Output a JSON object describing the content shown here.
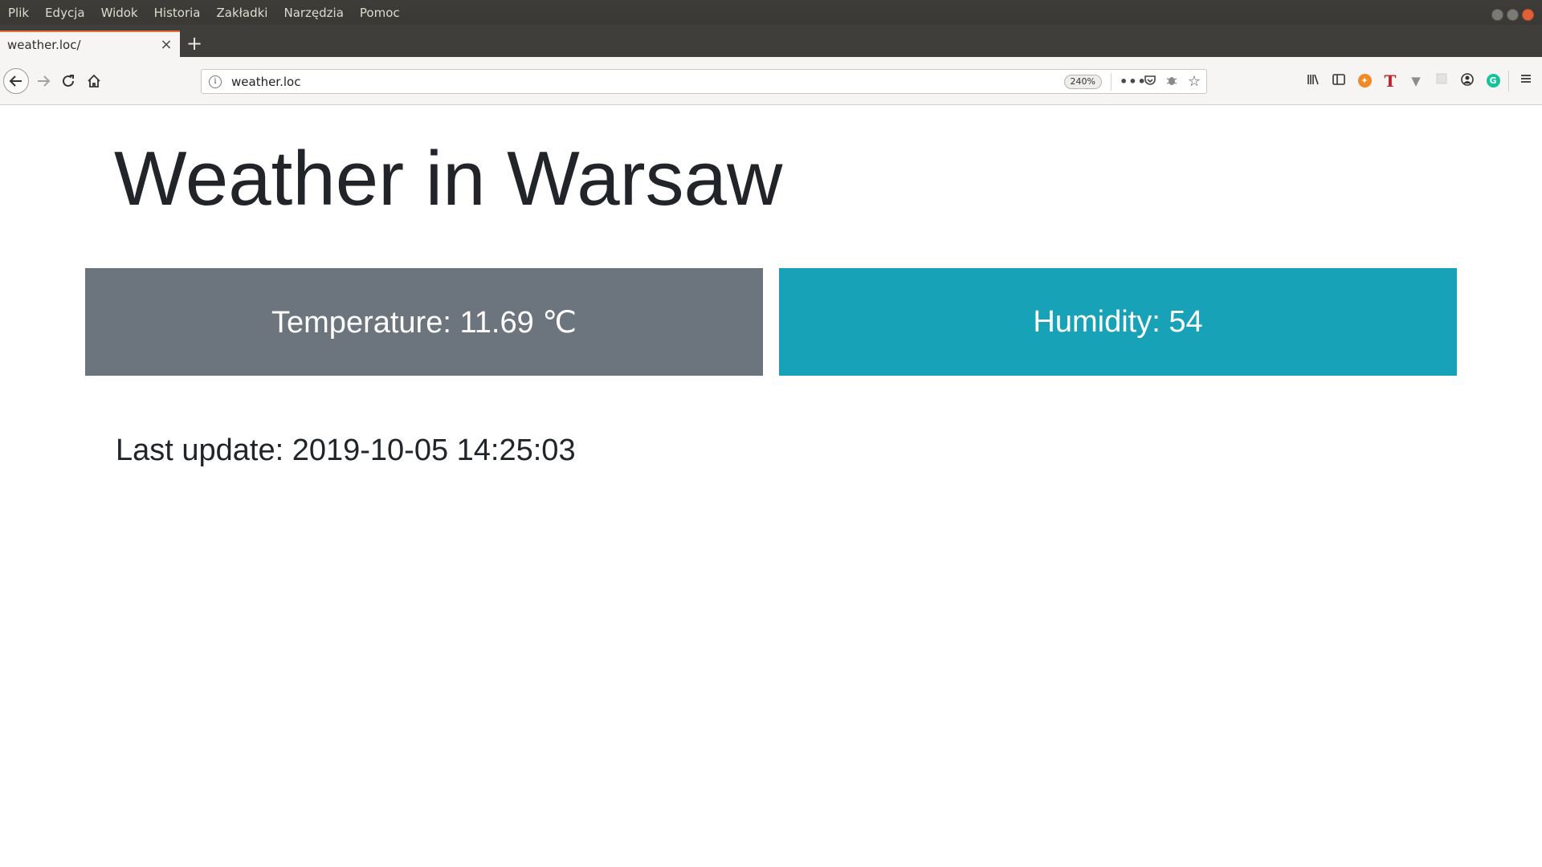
{
  "menubar": {
    "items": [
      "Plik",
      "Edycja",
      "Widok",
      "Historia",
      "Zakładki",
      "Narzędzia",
      "Pomoc"
    ]
  },
  "tab": {
    "title": "weather.loc/",
    "close_icon": "close-icon",
    "new_tab_icon": "plus-icon"
  },
  "navbar": {
    "url": "weather.loc",
    "zoom": "240%",
    "buttons": [
      "back-icon",
      "forward-icon",
      "reload-icon",
      "home-icon"
    ],
    "url_actions": [
      "more-icon",
      "pocket-icon",
      "bug-icon",
      "star-icon"
    ],
    "toolbar_icons": [
      "library-icon",
      "sidebar-icon",
      "extension-orange-icon",
      "extension-t-icon",
      "extension-v-icon",
      "extension-blank-icon",
      "account-icon",
      "grammarly-icon",
      "menu-icon"
    ]
  },
  "page": {
    "title": "Weather in Warsaw",
    "temperature": "Temperature: 11.69 ℃",
    "humidity": "Humidity: 54",
    "last_update": "Last update: 2019-10-05 14:25:03"
  },
  "colors": {
    "temperature_card": "#6c757d",
    "humidity_card": "#17a2b8",
    "tab_accent": "#e86b3a"
  }
}
